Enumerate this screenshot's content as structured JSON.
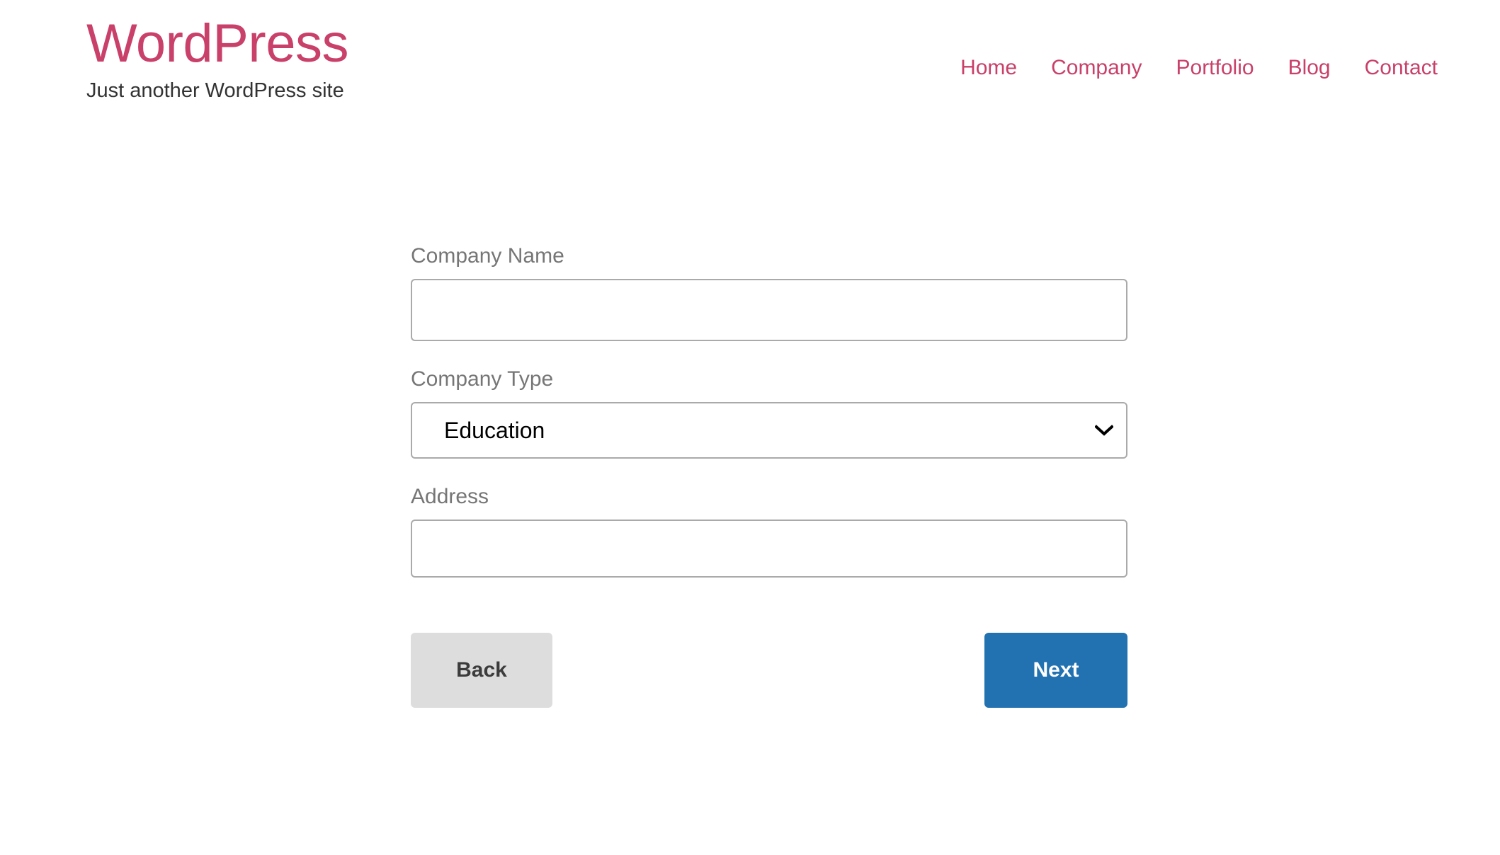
{
  "site": {
    "title": "WordPress",
    "tagline": "Just another WordPress site",
    "brand_color": "#c9406a"
  },
  "nav": {
    "items": [
      {
        "label": "Home"
      },
      {
        "label": "Company"
      },
      {
        "label": "Portfolio"
      },
      {
        "label": "Blog"
      },
      {
        "label": "Contact"
      }
    ]
  },
  "form": {
    "company_name": {
      "label": "Company Name",
      "value": "",
      "placeholder": ""
    },
    "company_type": {
      "label": "Company Type",
      "selected": "Education",
      "options": [
        "Education"
      ],
      "chevron_icon": "chevron-down-icon"
    },
    "address": {
      "label": "Address",
      "value": "",
      "placeholder": ""
    },
    "buttons": {
      "back_label": "Back",
      "next_label": "Next",
      "back_color": "#dddddd",
      "next_color": "#2271b1"
    }
  }
}
